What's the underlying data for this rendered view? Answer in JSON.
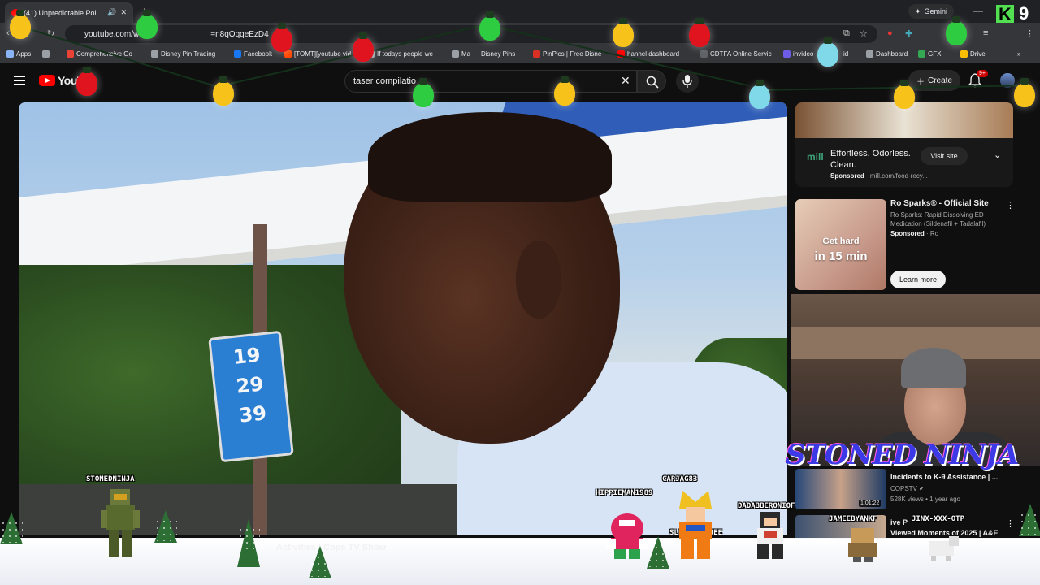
{
  "browser": {
    "tab_title": "(41) Unpredictable Poli",
    "new_tab": "+",
    "gemini": "Gemini",
    "url": "youtube.com/w",
    "url_tail": "=n8qOqqeEzD4",
    "bookmarks": [
      {
        "label": "Apps",
        "color": "#8ab4f8"
      },
      {
        "label": "Comprehensive Go",
        "color": "#ea4335"
      },
      {
        "label": "Disney Pin Trading",
        "color": "#9aa0a6"
      },
      {
        "label": "Facebook",
        "color": "#1877f2"
      },
      {
        "label": "[TOMT][youtube vid",
        "color": "#ff4500"
      },
      {
        "label": "If todays people we",
        "color": "#9aa0a6"
      },
      {
        "label": "Ma",
        "color": "#9aa0a6"
      },
      {
        "label": "Disney Pins",
        "color": "#9aa0a6"
      },
      {
        "label": "PinPics | Free Disne",
        "color": "#d93025"
      },
      {
        "label": "hannel dashboard",
        "color": "#ff0000"
      },
      {
        "label": "CDTFA Online Servic",
        "color": "#5f6368"
      },
      {
        "label": "invideo",
        "color": "#6c5ce7"
      },
      {
        "label": "id",
        "color": "#9aa0a6"
      },
      {
        "label": "Dashboard",
        "color": "#9aa0a6"
      },
      {
        "label": "GFX",
        "color": "#34a853"
      },
      {
        "label": "Drive",
        "color": "#fbbc04"
      }
    ]
  },
  "brand": {
    "k": "K",
    "nine": "9"
  },
  "youtube": {
    "logo_text": "YouT",
    "search_value": "taser compilatio",
    "create_label": "Create",
    "notif_badge": "9+"
  },
  "video": {
    "sign_prices": [
      "19",
      "29",
      "39"
    ],
    "title_fragment": "Activities | Cops TV Show"
  },
  "sidebar": {
    "ad1": {
      "logo": "mill",
      "title": "Effortless. Odorless. Clean.",
      "sponsored": "Sponsored",
      "domain": "mill.com/food-recy...",
      "cta": "Visit site"
    },
    "ad2": {
      "thumb_line1": "Get hard",
      "thumb_line2": "in 15 min",
      "title": "Ro Sparks® - Official Site",
      "desc": "Ro Sparks: Rapid Dissolving ED Medication (Sildenafil + Tadalafil)",
      "sponsored": "Sponsored",
      "advertiser": "Ro",
      "cta": "Learn more"
    },
    "rec1": {
      "title": "Incidents to K-9 Assistance | ...",
      "channel": "COPSTV",
      "meta": "528K views • 1 year ago",
      "duration": "1:01:22"
    },
    "rec2": {
      "title_line1": "ive P",
      "title_line2": "Viewed Moments of 2025 | A&E"
    }
  },
  "overlay": {
    "stoned_ninja": "STONED NINJA",
    "usernames": [
      "STONEDNINJA",
      "HIPPIEMAN1989",
      "CARJAG83",
      "DADABBERONIOF",
      "SLEVENDEGREE",
      "JAMEEBYANKF",
      "JINX-XXX-OTP"
    ]
  },
  "colors": {
    "bg": "#0f0f0f",
    "yt_red": "#ff0000",
    "bulb_green": "#2ecc40",
    "bulb_red": "#e0141e",
    "bulb_yellow": "#f7c21a",
    "bulb_cyan": "#7fd9e8"
  }
}
